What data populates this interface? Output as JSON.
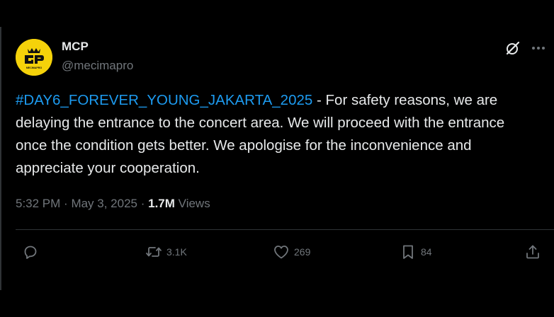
{
  "user": {
    "name": "MCP",
    "handle": "@mecimapro",
    "avatar_text": "MECIMAPRO"
  },
  "tweet": {
    "hashtag": "#DAY6_FOREVER_YOUNG_JAKARTA_2025",
    "body": " - For safety reasons, we are delaying the entrance to the concert area. We will proceed with the entrance once the condition gets better. We apologise for the inconvenience and appreciate your cooperation.",
    "time": "5:32 PM",
    "date": "May 3, 2025",
    "views_count": "1.7M",
    "views_label": "Views"
  },
  "actions": {
    "retweets": "3.1K",
    "likes": "269",
    "bookmarks": "84"
  },
  "icons": [
    "grok-icon",
    "more-icon",
    "reply-icon",
    "retweet-icon",
    "like-icon",
    "bookmark-icon",
    "share-icon"
  ],
  "colors": {
    "background": "#000000",
    "text": "#e7e9ea",
    "muted": "#71767b",
    "link": "#1d9bf0",
    "avatar": "#f5d20a"
  }
}
